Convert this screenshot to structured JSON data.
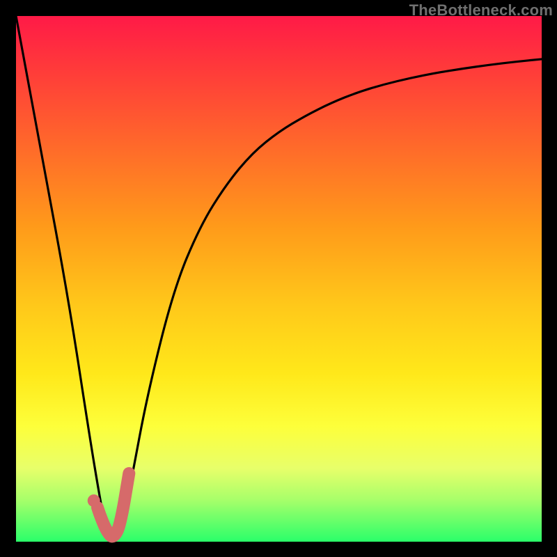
{
  "watermark": "TheBottleneck.com",
  "chart_data": {
    "type": "line",
    "title": "",
    "xlabel": "",
    "ylabel": "",
    "xlim": [
      0,
      100
    ],
    "ylim": [
      0,
      100
    ],
    "grid": false,
    "series": [
      {
        "name": "bottleneck-curve",
        "x": [
          0,
          5,
          10,
          14,
          16,
          17,
          18,
          19,
          20,
          22,
          25,
          30,
          35,
          40,
          45,
          50,
          55,
          60,
          65,
          70,
          75,
          80,
          85,
          90,
          95,
          100
        ],
        "values": [
          100,
          73,
          46,
          20,
          8,
          3,
          1,
          0,
          2,
          12,
          28,
          48,
          60,
          68,
          74,
          78,
          81,
          83.5,
          85.5,
          87,
          88.2,
          89.2,
          90,
          90.7,
          91.3,
          91.8
        ]
      },
      {
        "name": "highlight-j",
        "x": [
          15.5,
          16,
          17,
          18,
          18.5,
          19,
          19.5,
          20,
          20.5,
          21,
          21.5
        ],
        "values": [
          6.5,
          5,
          2.5,
          1,
          1,
          1.5,
          2.5,
          4.5,
          7,
          10,
          13
        ]
      },
      {
        "name": "highlight-dot",
        "x": [
          14.8
        ],
        "values": [
          7.8
        ]
      }
    ],
    "colors": {
      "curve": "#000000",
      "highlight": "#d66a6a"
    }
  }
}
